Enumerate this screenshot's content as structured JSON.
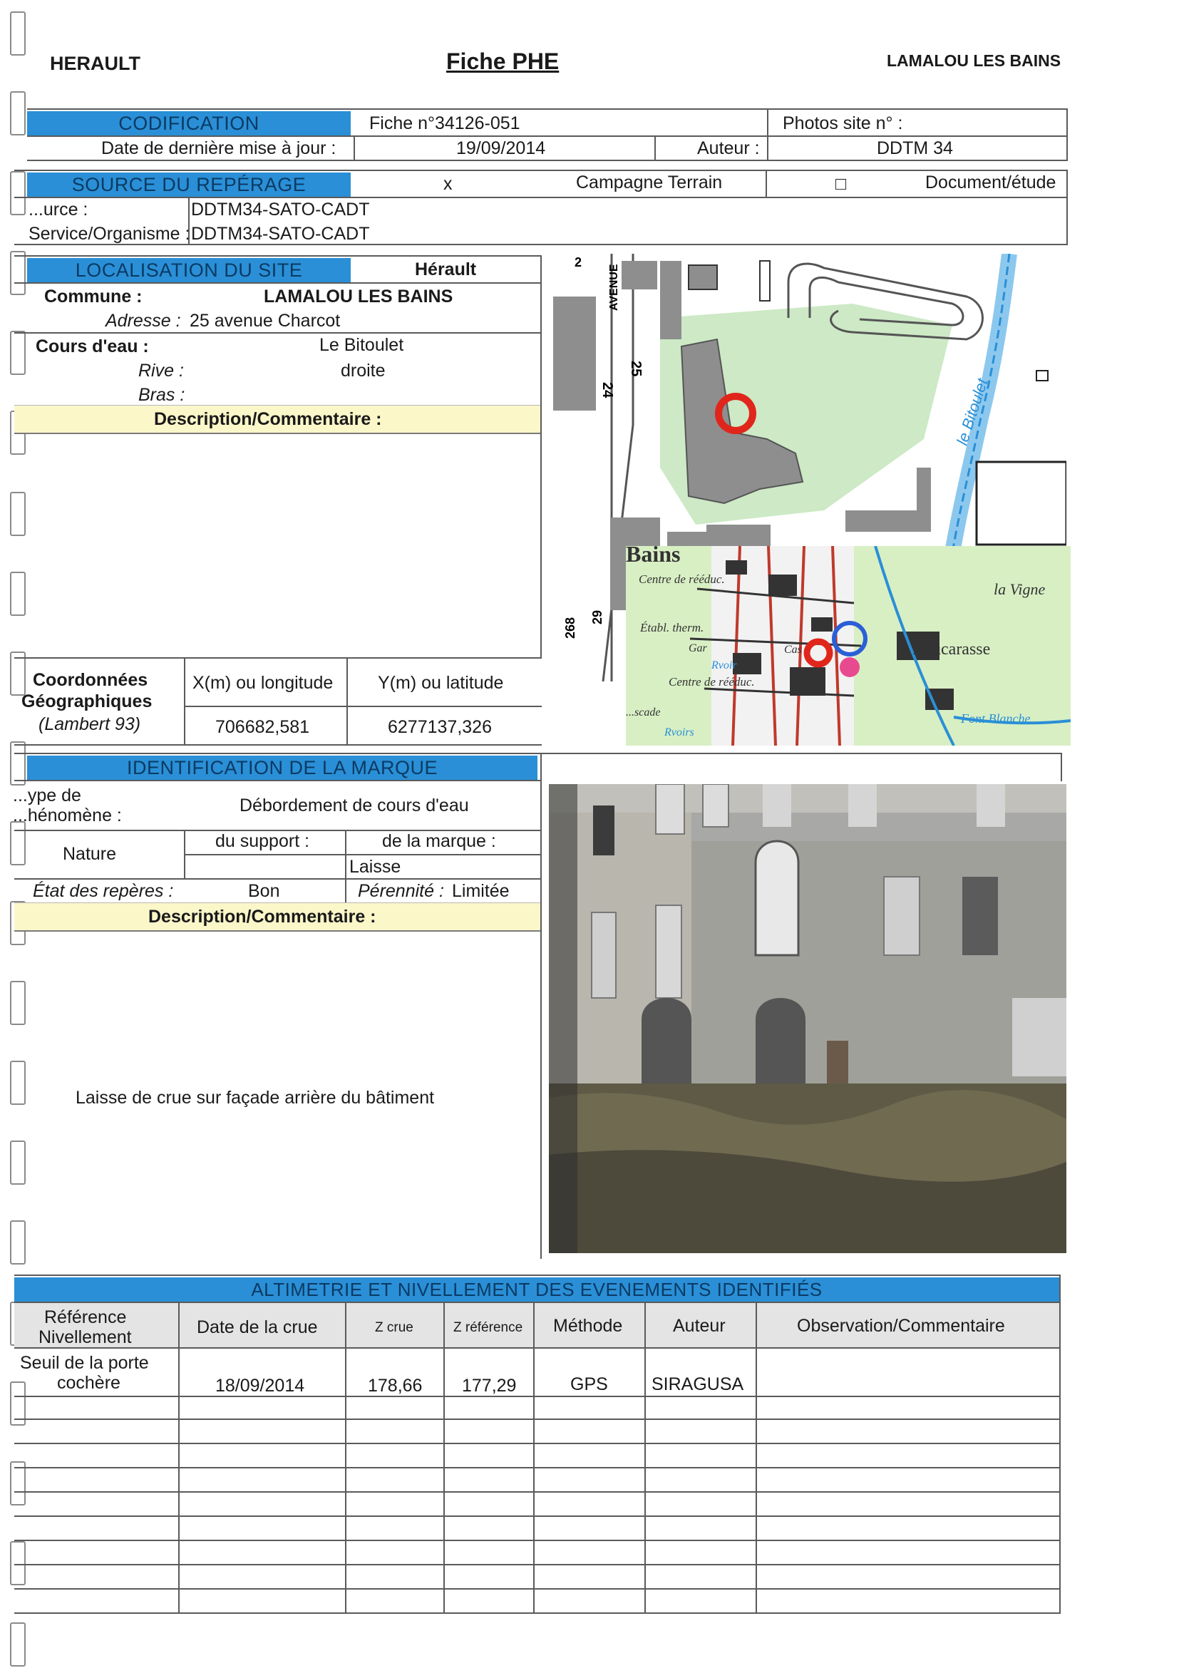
{
  "header": {
    "department": "HERAULT",
    "title": "Fiche PHE",
    "commune": "LAMALOU LES BAINS"
  },
  "codification": {
    "heading": "CODIFICATION",
    "fiche": "Fiche n°34126-051",
    "photos_label": "Photos site n° :",
    "date_label": "Date de dernière mise à jour :",
    "date_value": "19/09/2014",
    "auteur_label": "Auteur :",
    "auteur_value": "DDTM 34"
  },
  "source": {
    "heading": "SOURCE DU REPÉRAGE",
    "campagne_mark": "x",
    "campagne_label": "Campagne Terrain",
    "document_mark": "□",
    "document_label": "Document/étude",
    "source_label": "...urce :",
    "source_value": "DDTM34-SATO-CADT",
    "service_label": "Service/Organisme :",
    "service_value": "DDTM34-SATO-CADT"
  },
  "localisation": {
    "heading": "LOCALISATION DU SITE",
    "departement": "Hérault",
    "commune_label": "Commune :",
    "commune_value": "LAMALOU LES BAINS",
    "adresse_label": "Adresse :",
    "adresse_value": "25 avenue Charcot",
    "cours_label": "Cours d'eau :",
    "cours_value": "Le Bitoulet",
    "rive_label": "Rive :",
    "rive_value": "droite",
    "bras_label": "Bras :",
    "description_label": "Description/Commentaire :"
  },
  "coordonnees": {
    "label_1": "Coordonnées",
    "label_2": "Géographiques",
    "label_3": "(Lambert 93)",
    "x_label": "X(m) ou longitude",
    "y_label": "Y(m) ou latitude",
    "x_value": "706682,581",
    "y_value": "6277137,326"
  },
  "map_labels": {
    "avenue": "AVENUE",
    "n2": "2",
    "n24": "24",
    "n25": "25",
    "n29": "29",
    "n268": "268",
    "bitoulet": "le Bitoulet",
    "bains": "Bains",
    "centre_reeduc": "Centre de rééduc.",
    "etabl_therm": "Établ. therm.",
    "rvoir": "Rvoir",
    "centre_reeduc2": "Centre de rééduc.",
    "rvoirs": "Rvoirs",
    "cascade": "...scade",
    "gar": "Gar",
    "cas": "Cas",
    "la_vigne": "la Vigne",
    "roucarasse": "Roucarasse",
    "font_blanche": "Font Blanche"
  },
  "identification": {
    "heading": "IDENTIFICATION DE LA MARQUE",
    "type_label_1": "...ype de",
    "type_label_2": "...hénomène :",
    "type_value": "Débordement de cours d'eau",
    "nature_label": "Nature",
    "support_label": "du support :",
    "marque_label": "de la marque :",
    "marque_value": "Laisse",
    "etat_label": "État des repères :",
    "etat_value": "Bon",
    "perennite_label": "Pérennité :",
    "perennite_value": "Limitée",
    "description_label": "Description/Commentaire :",
    "description_value": "Laisse de crue sur façade arrière du bâtiment"
  },
  "altimetrie": {
    "heading": "ALTIMETRIE ET NIVELLEMENT DES EVENEMENTS IDENTIFIÉS",
    "columns": {
      "reference_1": "Référence",
      "reference_2": "Nivellement",
      "date": "Date de la crue",
      "zcrue": "Z crue",
      "zref": "Z référence",
      "methode": "Méthode",
      "auteur": "Auteur",
      "observation": "Observation/Commentaire"
    },
    "row1": {
      "reference_1": "Seuil de la porte",
      "reference_2": "cochère",
      "date": "18/09/2014",
      "zcrue": "178,66",
      "zref": "177,29",
      "methode": "GPS",
      "auteur": "SIRAGUSA",
      "observation": ""
    }
  },
  "colors": {
    "section_blue": "#2a8fd6",
    "comment_yellow": "#fbf7c9",
    "header_grey": "#e4e4e4",
    "map_marker": "#e0261b"
  }
}
